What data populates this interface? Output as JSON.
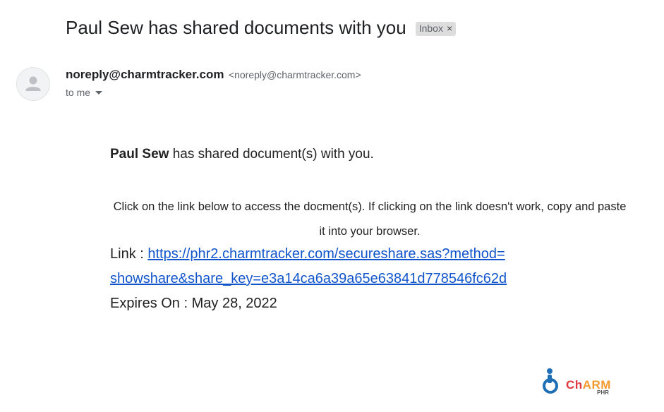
{
  "email": {
    "subject": "Paul Sew has shared documents with you",
    "label": "Inbox",
    "label_remove": "×",
    "sender": {
      "name": "noreply@charmtracker.com",
      "email": "<noreply@charmtracker.com>"
    },
    "recipient": "to me"
  },
  "body": {
    "sharer_name": "Paul Sew",
    "share_message": " has shared document(s) with you.",
    "instructions": "Click on the link below to access the docment(s). If clicking on the link doesn't work, copy and paste it into your browser.",
    "link_label": "Link : ",
    "link_url_line1": "https://phr2.charmtracker.com/secureshare.sas?method=",
    "link_url_line2": "showshare&share_key=e3a14ca6a39a65e63841d778546fc62d",
    "expires_label": "Expires On : ",
    "expires_date": "May 28, 2022"
  },
  "logo": {
    "text_ch": "Ch",
    "text_arm": "ARM",
    "subtext": "PHR",
    "colors": {
      "blue": "#1e6fb5",
      "red": "#e0383e",
      "orange": "#f29a2e",
      "yellow": "#e6b800",
      "green": "#7ab648"
    }
  },
  "colors": {
    "link": "#1155cc",
    "chip_bg": "#dddddd",
    "muted": "#5f6368"
  },
  "icons": {
    "avatar": "person-icon",
    "label_close": "close-icon",
    "recipient_details": "caret-down-icon",
    "brand": "charm-logo-icon"
  }
}
